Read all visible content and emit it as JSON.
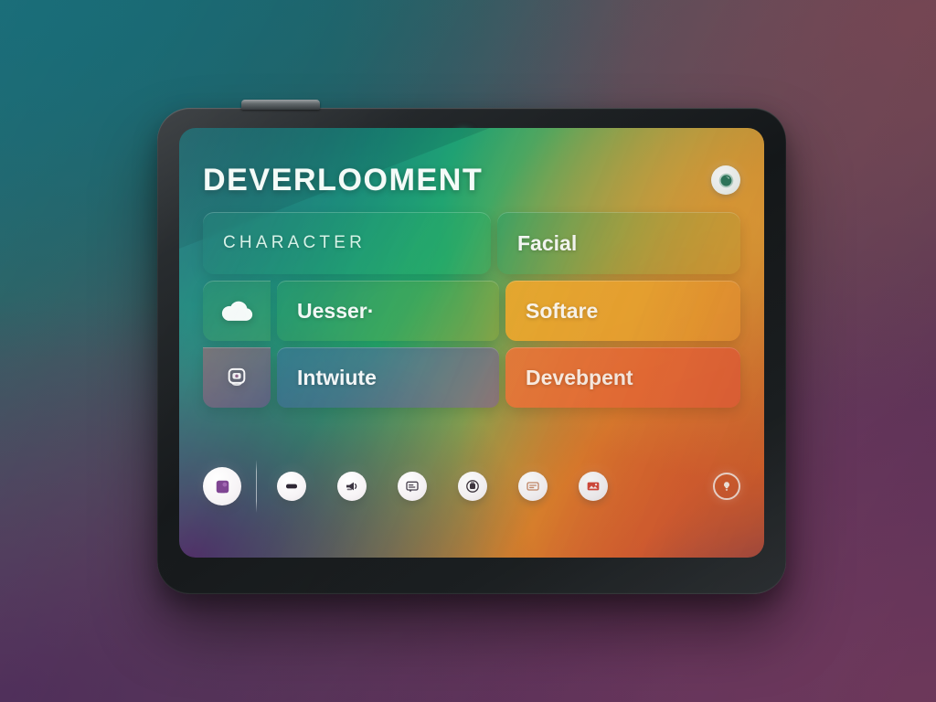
{
  "app": {
    "title": "DEVERLOOMENT",
    "header_action": {
      "name": "avatar-settings",
      "icon": "gear-avatar-icon"
    },
    "status_led": {
      "name": "power-led",
      "color": "#1fe0a8"
    }
  },
  "tiles": {
    "row1": [
      {
        "key": "character",
        "label": "CHARACTER",
        "color": "#1ea06e"
      },
      {
        "key": "facial",
        "label": "Facial",
        "color": "#4fa85a"
      }
    ],
    "row2": [
      {
        "key": "cloud-icon",
        "label": "",
        "icon": "cloud-icon",
        "color": "#2c9c64"
      },
      {
        "key": "user",
        "label": "Uesser·",
        "color": "#56a64c"
      },
      {
        "key": "software",
        "label": "Softare",
        "color": "#f0aa2d"
      }
    ],
    "row3": [
      {
        "key": "robot-icon",
        "label": "",
        "icon": "robot-face-icon",
        "color": "#a8606e"
      },
      {
        "key": "intuitive",
        "label": "Intwiute",
        "color": "#60629e"
      },
      {
        "key": "development",
        "label": "Devebpent",
        "color": "#ec7a3a"
      }
    ]
  },
  "dock": {
    "items": [
      {
        "name": "dock-item-home",
        "icon": "rounded-square-icon",
        "style": "active",
        "accent": "#7b3f8f"
      },
      {
        "name": "dock-item-minus",
        "icon": "pill-minus-icon",
        "style": "std",
        "accent": "#2a2330"
      },
      {
        "name": "dock-item-speaker",
        "icon": "megaphone-icon",
        "style": "std",
        "accent": "#3a3340"
      },
      {
        "name": "dock-item-card",
        "icon": "message-card-icon",
        "style": "std",
        "accent": "#4a4350"
      },
      {
        "name": "dock-item-badge",
        "icon": "circle-badge-icon",
        "style": "std",
        "accent": "#3f3640"
      },
      {
        "name": "dock-item-lines",
        "icon": "text-lines-icon",
        "style": "std",
        "accent": "#c78a6a"
      },
      {
        "name": "dock-item-photo",
        "icon": "photo-card-icon",
        "style": "std",
        "accent": "#d64a3c"
      },
      {
        "name": "dock-item-bulb",
        "icon": "bulb-pin-icon",
        "style": "ring",
        "accent": "#fff2e8"
      }
    ]
  },
  "device": {
    "frame": "tablet-frame",
    "nub": "top-button-nub"
  }
}
